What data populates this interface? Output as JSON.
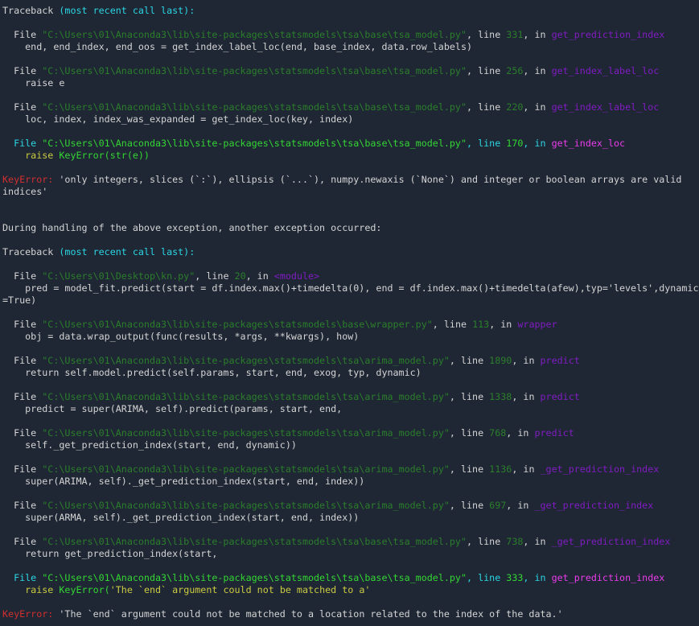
{
  "terminal": {
    "description": "Python console traceback output",
    "colors": {
      "bg": "#1f2734",
      "fg": "#d4d4d4",
      "cy": "#2bd5e2",
      "gd": "#2b7e2b",
      "gb": "#33d633",
      "pu": "#801cc2",
      "mb": "#ea3bea",
      "rd": "#d12f2f",
      "ye": "#cbcb41"
    },
    "lines": [
      [
        {
          "t": "Traceback ",
          "c": "fg"
        },
        {
          "t": "(most recent call last):",
          "c": "cy"
        }
      ],
      [],
      [
        {
          "t": "  File ",
          "c": "fg"
        },
        {
          "t": "\"C:\\Users\\01\\Anaconda3\\lib\\site-packages\\statsmodels\\tsa\\base\\tsa_model.py\"",
          "c": "gd"
        },
        {
          "t": ", line ",
          "c": "fg"
        },
        {
          "t": "331",
          "c": "gd"
        },
        {
          "t": ", in ",
          "c": "fg"
        },
        {
          "t": "get_prediction_index",
          "c": "pu"
        }
      ],
      [
        {
          "t": "    end, end_index, end_oos = get_index_label_loc(end, base_index, data.row_labels)",
          "c": "fg"
        }
      ],
      [],
      [
        {
          "t": "  File ",
          "c": "fg"
        },
        {
          "t": "\"C:\\Users\\01\\Anaconda3\\lib\\site-packages\\statsmodels\\tsa\\base\\tsa_model.py\"",
          "c": "gd"
        },
        {
          "t": ", line ",
          "c": "fg"
        },
        {
          "t": "256",
          "c": "gd"
        },
        {
          "t": ", in ",
          "c": "fg"
        },
        {
          "t": "get_index_label_loc",
          "c": "pu"
        }
      ],
      [
        {
          "t": "    raise e",
          "c": "fg"
        }
      ],
      [],
      [
        {
          "t": "  File ",
          "c": "fg"
        },
        {
          "t": "\"C:\\Users\\01\\Anaconda3\\lib\\site-packages\\statsmodels\\tsa\\base\\tsa_model.py\"",
          "c": "gd"
        },
        {
          "t": ", line ",
          "c": "fg"
        },
        {
          "t": "220",
          "c": "gd"
        },
        {
          "t": ", in ",
          "c": "fg"
        },
        {
          "t": "get_index_label_loc",
          "c": "pu"
        }
      ],
      [
        {
          "t": "    loc, index, index_was_expanded = get_index_loc(key, index)",
          "c": "fg"
        }
      ],
      [],
      [
        {
          "t": "  File ",
          "c": "cy"
        },
        {
          "t": "\"C:\\Users\\01\\Anaconda3\\lib\\site-packages\\statsmodels\\tsa\\base\\tsa_model.py\"",
          "c": "gb"
        },
        {
          "t": ", line ",
          "c": "cy"
        },
        {
          "t": "170",
          "c": "gb"
        },
        {
          "t": ", in ",
          "c": "cy"
        },
        {
          "t": "get_index_loc",
          "c": "mb"
        }
      ],
      [
        {
          "t": "    raise ",
          "c": "ye"
        },
        {
          "t": "KeyError(str(e))",
          "c": "gb"
        }
      ],
      [],
      [
        {
          "t": "KeyError:",
          "c": "rd"
        },
        {
          "t": " 'only integers, slices (`:`), ellipsis (`...`), numpy.newaxis (`None`) and integer or boolean arrays are valid",
          "c": "fg"
        }
      ],
      [
        {
          "t": "indices'",
          "c": "fg"
        }
      ],
      [],
      [],
      [
        {
          "t": "During handling of the above exception, another exception occurred:",
          "c": "fg"
        }
      ],
      [],
      [
        {
          "t": "Traceback ",
          "c": "fg"
        },
        {
          "t": "(most recent call last):",
          "c": "cy"
        }
      ],
      [],
      [
        {
          "t": "  File ",
          "c": "fg"
        },
        {
          "t": "\"C:\\Users\\01\\Desktop\\kn.py\"",
          "c": "gd"
        },
        {
          "t": ", line ",
          "c": "fg"
        },
        {
          "t": "20",
          "c": "gd"
        },
        {
          "t": ", in ",
          "c": "fg"
        },
        {
          "t": "<module>",
          "c": "pu"
        }
      ],
      [
        {
          "t": "    pred = model_fit.predict(start = df.index.max()+timedelta(0), end = df.index.max()+timedelta(afew),typ='levels',dynamic",
          "c": "fg"
        }
      ],
      [
        {
          "t": "=True)",
          "c": "fg"
        }
      ],
      [],
      [
        {
          "t": "  File ",
          "c": "fg"
        },
        {
          "t": "\"C:\\Users\\01\\Anaconda3\\lib\\site-packages\\statsmodels\\base\\wrapper.py\"",
          "c": "gd"
        },
        {
          "t": ", line ",
          "c": "fg"
        },
        {
          "t": "113",
          "c": "gd"
        },
        {
          "t": ", in ",
          "c": "fg"
        },
        {
          "t": "wrapper",
          "c": "pu"
        }
      ],
      [
        {
          "t": "    obj = data.wrap_output(func(results, *args, **kwargs), how)",
          "c": "fg"
        }
      ],
      [],
      [
        {
          "t": "  File ",
          "c": "fg"
        },
        {
          "t": "\"C:\\Users\\01\\Anaconda3\\lib\\site-packages\\statsmodels\\tsa\\arima_model.py\"",
          "c": "gd"
        },
        {
          "t": ", line ",
          "c": "fg"
        },
        {
          "t": "1890",
          "c": "gd"
        },
        {
          "t": ", in ",
          "c": "fg"
        },
        {
          "t": "predict",
          "c": "pu"
        }
      ],
      [
        {
          "t": "    return self.model.predict(self.params, start, end, exog, typ, dynamic)",
          "c": "fg"
        }
      ],
      [],
      [
        {
          "t": "  File ",
          "c": "fg"
        },
        {
          "t": "\"C:\\Users\\01\\Anaconda3\\lib\\site-packages\\statsmodels\\tsa\\arima_model.py\"",
          "c": "gd"
        },
        {
          "t": ", line ",
          "c": "fg"
        },
        {
          "t": "1338",
          "c": "gd"
        },
        {
          "t": ", in ",
          "c": "fg"
        },
        {
          "t": "predict",
          "c": "pu"
        }
      ],
      [
        {
          "t": "    predict = super(ARIMA, self).predict(params, start, end,",
          "c": "fg"
        }
      ],
      [],
      [
        {
          "t": "  File ",
          "c": "fg"
        },
        {
          "t": "\"C:\\Users\\01\\Anaconda3\\lib\\site-packages\\statsmodels\\tsa\\arima_model.py\"",
          "c": "gd"
        },
        {
          "t": ", line ",
          "c": "fg"
        },
        {
          "t": "768",
          "c": "gd"
        },
        {
          "t": ", in ",
          "c": "fg"
        },
        {
          "t": "predict",
          "c": "pu"
        }
      ],
      [
        {
          "t": "    self._get_prediction_index(start, end, dynamic))",
          "c": "fg"
        }
      ],
      [],
      [
        {
          "t": "  File ",
          "c": "fg"
        },
        {
          "t": "\"C:\\Users\\01\\Anaconda3\\lib\\site-packages\\statsmodels\\tsa\\arima_model.py\"",
          "c": "gd"
        },
        {
          "t": ", line ",
          "c": "fg"
        },
        {
          "t": "1136",
          "c": "gd"
        },
        {
          "t": ", in ",
          "c": "fg"
        },
        {
          "t": "_get_prediction_index",
          "c": "pu"
        }
      ],
      [
        {
          "t": "    super(ARIMA, self)._get_prediction_index(start, end, index))",
          "c": "fg"
        }
      ],
      [],
      [
        {
          "t": "  File ",
          "c": "fg"
        },
        {
          "t": "\"C:\\Users\\01\\Anaconda3\\lib\\site-packages\\statsmodels\\tsa\\arima_model.py\"",
          "c": "gd"
        },
        {
          "t": ", line ",
          "c": "fg"
        },
        {
          "t": "697",
          "c": "gd"
        },
        {
          "t": ", in ",
          "c": "fg"
        },
        {
          "t": "_get_prediction_index",
          "c": "pu"
        }
      ],
      [
        {
          "t": "    super(ARMA, self)._get_prediction_index(start, end, index))",
          "c": "fg"
        }
      ],
      [],
      [
        {
          "t": "  File ",
          "c": "fg"
        },
        {
          "t": "\"C:\\Users\\01\\Anaconda3\\lib\\site-packages\\statsmodels\\tsa\\base\\tsa_model.py\"",
          "c": "gd"
        },
        {
          "t": ", line ",
          "c": "fg"
        },
        {
          "t": "738",
          "c": "gd"
        },
        {
          "t": ", in ",
          "c": "fg"
        },
        {
          "t": "_get_prediction_index",
          "c": "pu"
        }
      ],
      [
        {
          "t": "    return get_prediction_index(start,",
          "c": "fg"
        }
      ],
      [],
      [
        {
          "t": "  File ",
          "c": "cy"
        },
        {
          "t": "\"C:\\Users\\01\\Anaconda3\\lib\\site-packages\\statsmodels\\tsa\\base\\tsa_model.py\"",
          "c": "gb"
        },
        {
          "t": ", line ",
          "c": "cy"
        },
        {
          "t": "333",
          "c": "gb"
        },
        {
          "t": ", in ",
          "c": "cy"
        },
        {
          "t": "get_prediction_index",
          "c": "mb"
        }
      ],
      [
        {
          "t": "    raise ",
          "c": "ye"
        },
        {
          "t": "KeyError(",
          "c": "gb"
        },
        {
          "t": "'The `end` argument could not be matched to a'",
          "c": "ye"
        }
      ],
      [],
      [
        {
          "t": "KeyError:",
          "c": "rd"
        },
        {
          "t": " 'The `end` argument could not be matched to a location related to the index of the data.'",
          "c": "fg"
        }
      ]
    ]
  }
}
